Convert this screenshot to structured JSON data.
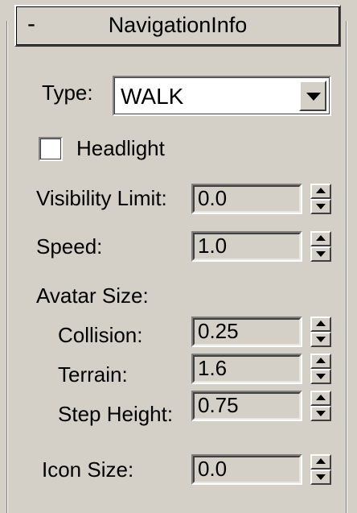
{
  "rollout": {
    "collapse_symbol": "-",
    "title": "NavigationInfo"
  },
  "type_row": {
    "label": "Type:",
    "value": "WALK"
  },
  "headlight": {
    "label": "Headlight",
    "checked": false
  },
  "visibility_limit": {
    "label": "Visibility Limit:",
    "value": "0.0"
  },
  "speed": {
    "label": "Speed:",
    "value": "1.0"
  },
  "avatar_size": {
    "label": "Avatar Size:",
    "collision": {
      "label": "Collision:",
      "value": "0.25"
    },
    "terrain": {
      "label": "Terrain:",
      "value": "1.6"
    },
    "step_height": {
      "label": "Step Height:",
      "value": "0.75"
    }
  },
  "icon_size": {
    "label": "Icon Size:",
    "value": "0.0"
  },
  "icons": {
    "dropdown": "chevron-down-icon",
    "spinner_up": "arrow-up-icon",
    "spinner_down": "arrow-down-icon"
  },
  "colors": {
    "panel_bg": "#d4d0c8",
    "highlight": "#ffffff",
    "shadow": "#808080",
    "dark_shadow": "#404040"
  }
}
